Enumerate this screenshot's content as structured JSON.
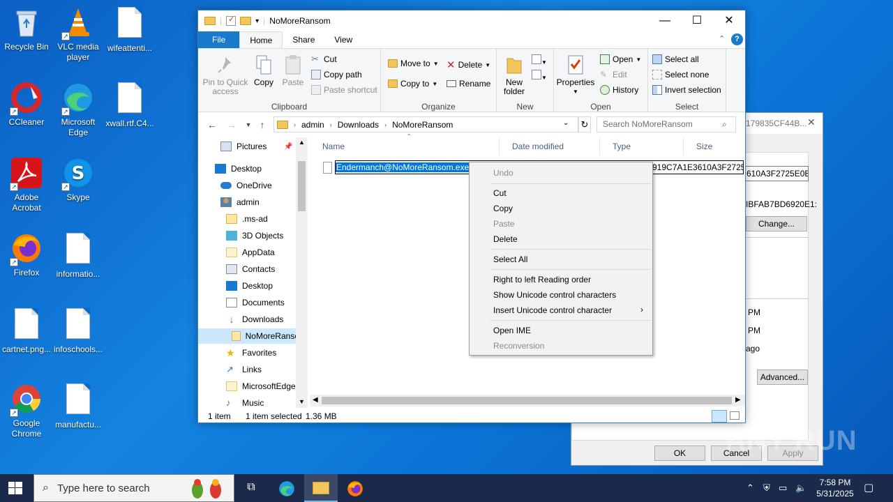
{
  "desktop": {
    "icons": [
      {
        "label": "Recycle Bin"
      },
      {
        "label": "VLC media player"
      },
      {
        "label": "wifeattenti..."
      },
      {
        "label": "CCleaner"
      },
      {
        "label": "Microsoft Edge"
      },
      {
        "label": "xwall.rtf.C4..."
      },
      {
        "label": "Adobe Acrobat"
      },
      {
        "label": "Skype"
      },
      {
        "label": "Firefox"
      },
      {
        "label": "informatio..."
      },
      {
        "label": "cartnet.png..."
      },
      {
        "label": "infoschools..."
      },
      {
        "label": "Google Chrome"
      },
      {
        "label": "manufactu..."
      }
    ]
  },
  "properties_dialog": {
    "title_partial": "179835CF44B...",
    "close": "✕",
    "hash_field_1": "610A3F2725E0B0",
    "hash_field_2": "IBFAB7BD6920E1:",
    "change_button": "Change...",
    "time_1": "PM",
    "time_2": "PM",
    "time_3": "ago",
    "advanced_button": "Advanced...",
    "ok_button": "OK",
    "cancel_button": "Cancel",
    "apply_button": "Apply"
  },
  "explorer": {
    "title": "NoMoreRansom",
    "controls": {
      "minimize": "—",
      "maximize": "☐",
      "close": "✕"
    },
    "tabs": [
      "File",
      "Home",
      "Share",
      "View"
    ],
    "ribbon": {
      "clipboard": {
        "label": "Clipboard",
        "pin": "Pin to Quick access",
        "copy": "Copy",
        "paste": "Paste",
        "cut": "Cut",
        "copy_path": "Copy path",
        "paste_shortcut": "Paste shortcut"
      },
      "organize": {
        "label": "Organize",
        "move_to": "Move to",
        "copy_to": "Copy to",
        "delete": "Delete",
        "rename": "Rename"
      },
      "new": {
        "label": "New",
        "new_folder": "New folder"
      },
      "open": {
        "label": "Open",
        "properties": "Properties",
        "open": "Open",
        "edit": "Edit",
        "history": "History"
      },
      "select": {
        "label": "Select",
        "select_all": "Select all",
        "select_none": "Select none",
        "invert": "Invert selection"
      }
    },
    "address": {
      "crumbs": [
        "admin",
        "Downloads",
        "NoMoreRansom"
      ]
    },
    "search": {
      "placeholder": "Search NoMoreRansom"
    },
    "nav": [
      "Pictures",
      "Desktop",
      "OneDrive",
      "admin",
      ".ms-ad",
      "3D Objects",
      "AppData",
      "Contacts",
      "Desktop",
      "Documents",
      "Downloads",
      "NoMoreRansom",
      "Favorites",
      "Links",
      "MicrosoftEdge",
      "Music"
    ],
    "columns": {
      "name": "Name",
      "date": "Date modified",
      "type": "Type",
      "size": "Size"
    },
    "file": {
      "selected_text": "Endermanch@NoMoreRansom.exe",
      "rest_text": "919C7A1E3610A3F2725E0"
    },
    "status": {
      "count": "1 item",
      "selected": "1 item selected",
      "size": "1.36 MB"
    }
  },
  "context_menu": {
    "undo": "Undo",
    "cut": "Cut",
    "copy": "Copy",
    "paste": "Paste",
    "delete": "Delete",
    "select_all": "Select All",
    "rtl": "Right to left Reading order",
    "show_unicode": "Show Unicode control characters",
    "insert_unicode": "Insert Unicode control character",
    "open_ime": "Open IME",
    "reconversion": "Reconversion"
  },
  "taskbar": {
    "search_placeholder": "Type here to search",
    "time": "7:58 PM",
    "date": "5/31/2025"
  },
  "watermark": "ANY RUN"
}
